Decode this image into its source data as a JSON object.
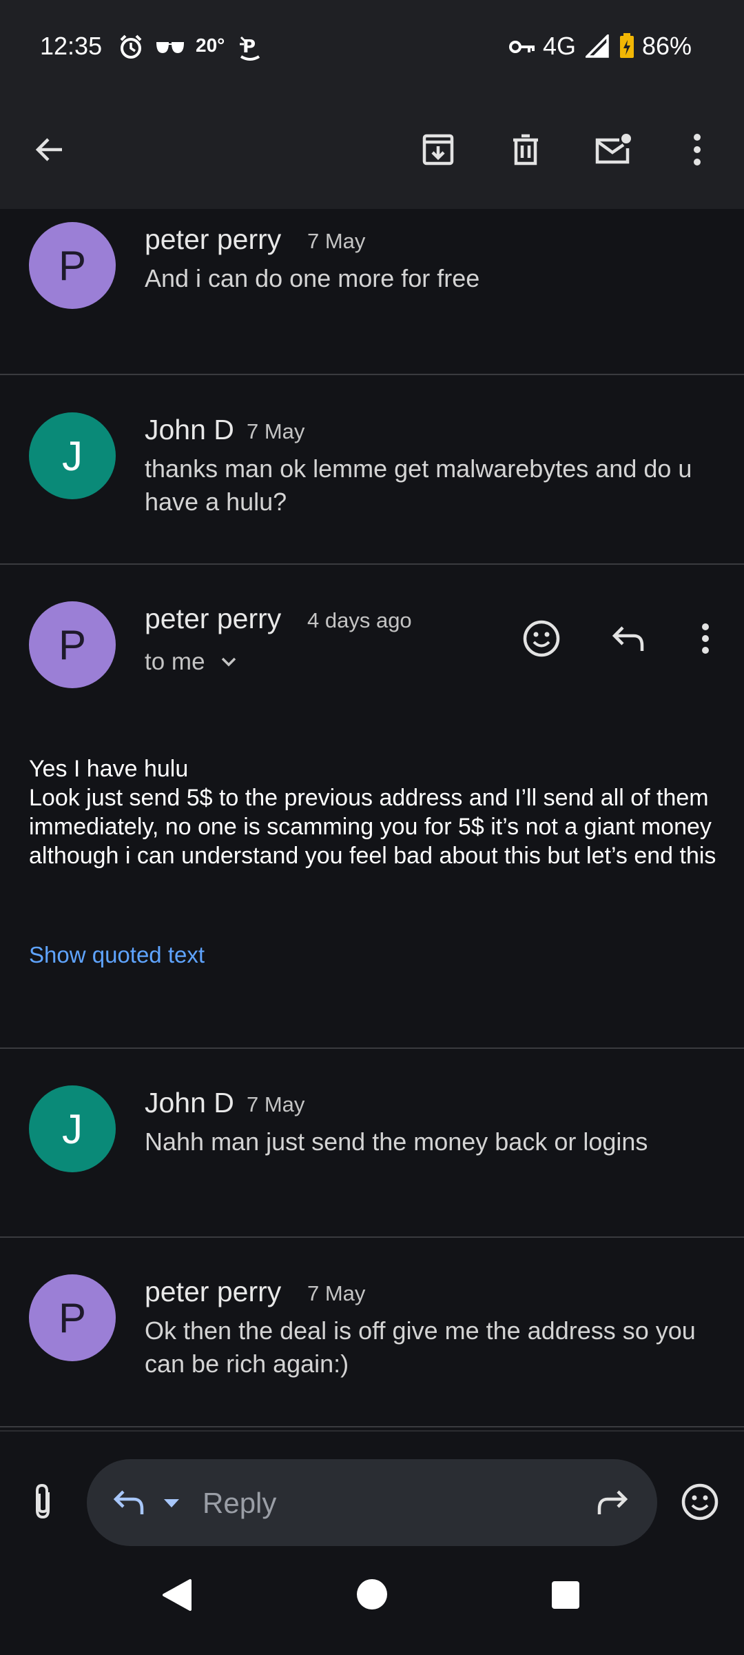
{
  "status_bar": {
    "time": "12:35",
    "temperature": "20°",
    "network": "4G",
    "battery": "86%",
    "icons": [
      "alarm-icon",
      "glasses-icon",
      "weather-icon",
      "vpn-key-icon",
      "signal-icon",
      "battery-icon"
    ]
  },
  "app_bar": {
    "icons": [
      "back-arrow-icon",
      "archive-icon",
      "delete-icon",
      "mark-unread-icon",
      "more-vert-icon"
    ]
  },
  "messages": [
    {
      "sender": "peter perry",
      "date": "7 May",
      "snippet": "And i can do one more for free",
      "avatar_letter": "P"
    },
    {
      "sender": "John D",
      "date": "7 May",
      "snippet": "thanks man ok lemme get malwarebytes and do u have a hulu?",
      "avatar_letter": "J"
    },
    {
      "sender": "peter perry",
      "date": "4 days ago",
      "recipient": "to me",
      "avatar_letter": "P",
      "body_lines": [
        "Yes I have hulu",
        "Look just send 5$ to the previous address and I’ll send all of them immediately, no one is scamming you for 5$ it’s not a giant money although i can understand you feel bad about this but let’s end this"
      ],
      "show_quoted": "Show quoted text"
    },
    {
      "sender": "John D",
      "date": "7 May",
      "snippet": "Nahh man just send the money back or logins",
      "avatar_letter": "J"
    },
    {
      "sender": "peter perry",
      "date": "7 May",
      "snippet": "Ok then the deal is off give me the address so you can be rich again:)",
      "avatar_letter": "P"
    }
  ],
  "reply_bar": {
    "placeholder": "Reply",
    "icons": [
      "attach-icon",
      "reply-icon",
      "dropdown-icon",
      "forward-icon",
      "emoji-icon"
    ]
  },
  "colors": {
    "background": "#121317",
    "bar": "#1f2024",
    "avatar_p": "#9b7fd6",
    "avatar_j": "#0a8a78",
    "link": "#5fa4ff"
  }
}
